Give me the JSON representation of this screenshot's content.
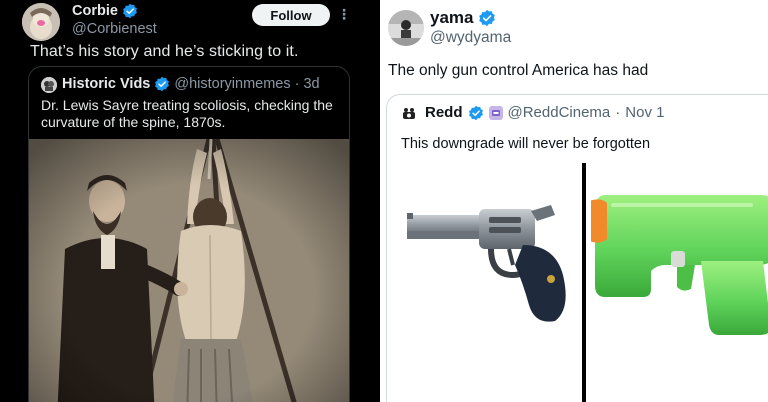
{
  "left_tweet": {
    "author_name": "Corbie",
    "author_handle": "@Corbienest",
    "follow_label": "Follow",
    "more_icon": "⋮",
    "text": "That’s his story and he’s sticking to it.",
    "quoted": {
      "author_name": "Historic Vids",
      "author_handle": "@historyinmemes",
      "separator": "·",
      "time": "3d",
      "text": "Dr. Lewis Sayre treating scoliosis, checking the curvature of the spine, 1870s.",
      "image_icon": "sepia-photo"
    }
  },
  "right_tweet": {
    "author_name": "yama",
    "author_handle": "@wydyama",
    "text": "The only gun control America has had",
    "quoted": {
      "author_name": "Redd",
      "author_handle": "@ReddCinema",
      "separator": "·",
      "time": "Nov 1",
      "text": "This downgrade will never be forgotten",
      "images": [
        "revolver-emoji",
        "water-gun-emoji"
      ]
    }
  },
  "colors": {
    "verified_blue": "#1d9bf0",
    "dark_bg": "#000000",
    "light_bg": "#ffffff",
    "water_gun_green": "#5fd35a",
    "water_gun_orange": "#f08a2a"
  }
}
